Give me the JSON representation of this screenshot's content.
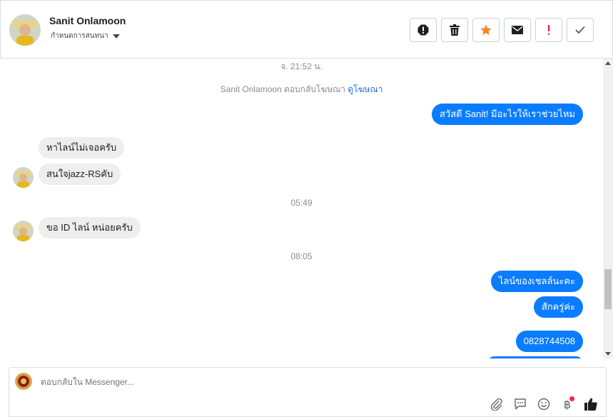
{
  "header": {
    "name": "Sanit Onlamoon",
    "subtitle": "กำหนดการสนทนา"
  },
  "actions": [
    {
      "name": "report-icon"
    },
    {
      "name": "trash-icon"
    },
    {
      "name": "star-icon",
      "color": "#f5821f"
    },
    {
      "name": "envelope-icon"
    },
    {
      "name": "exclamation-icon",
      "color": "#e41e3f"
    },
    {
      "name": "checkmark-icon"
    }
  ],
  "conversation": {
    "stamp1": "จ. 21:52 น.",
    "sys_prefix": "Sanit Onlamoon ตอบกลับโฆษณา",
    "sys_link": "ดูโฆษณา",
    "out1": "สวัสดี Sanit! มีอะไรให้เราช่วยไหม",
    "in1": "หาไลน์ไม่เจอครับ",
    "in2": "สนใจjazz-RSคับ",
    "stamp2": "05:49",
    "in3": "ขอ ID ไลน์ หน่อยครับ",
    "stamp3": "08:05",
    "out2": "ไลน์ของเชลล์นะคะ",
    "out3": "สักครู่ค่ะ",
    "out4": "0828744508"
  },
  "composer": {
    "placeholder": "ตอบกลับใน Messenger...",
    "baht": "฿"
  },
  "colors": {
    "outgoing_bubble": "#0a7cff",
    "incoming_bubble": "#eeeeee",
    "link": "#216fdb"
  }
}
